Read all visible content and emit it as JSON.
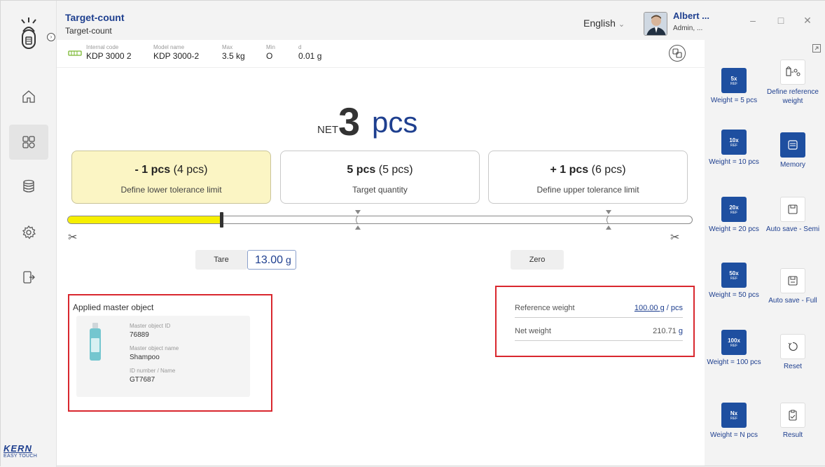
{
  "header": {
    "title": "Target-count",
    "subtitle": "Target-count",
    "language": "English",
    "user_name": "Albert ...",
    "user_role": "Admin, ..."
  },
  "device": {
    "internal_code_label": "Internal code",
    "internal_code": "KDP 3000 2",
    "model_label": "Model name",
    "model": "KDP 3000-2",
    "max_label": "Max",
    "max": "3.5 kg",
    "min_label": "Min",
    "min": "O",
    "d_label": "d",
    "d": "0.01 g"
  },
  "result": {
    "net_label": "NET",
    "value": "3",
    "unit": "pcs"
  },
  "tolerances": {
    "lower_value": "- 1 pcs",
    "lower_paren": "(4 pcs)",
    "lower_label": "Define lower tolerance limit",
    "target_value": "5 pcs",
    "target_paren": "(5 pcs)",
    "target_label": "Target quantity",
    "upper_value": "+ 1 pcs",
    "upper_paren": "(6 pcs)",
    "upper_label": "Define upper tolerance limit"
  },
  "progress": {
    "fill_fraction": 0.246
  },
  "controls": {
    "tare_label": "Tare",
    "tare_value": "13.00",
    "tare_unit": "g",
    "zero_label": "Zero"
  },
  "master": {
    "title": "Applied master object",
    "id_label": "Master object ID",
    "id": "76889",
    "name_label": "Master object name",
    "name": "Shampoo",
    "idnum_label": "ID number / Name",
    "idnum": "GT7687"
  },
  "reference": {
    "ref_label": "Reference weight",
    "ref_value": "100.00 g",
    "ref_unit": "/ pcs",
    "net_label": "Net weight",
    "net_value": "210.71",
    "net_unit": "g"
  },
  "right_panel": {
    "w5_mult": "5x",
    "w5_ref": "REF",
    "w5_label": "Weight = 5 pcs",
    "w10_mult": "10x",
    "w10_ref": "REF",
    "w10_label": "Weight = 10 pcs",
    "w20_mult": "20x",
    "w20_ref": "REF",
    "w20_label": "Weight = 20 pcs",
    "w50_mult": "50x",
    "w50_ref": "REF",
    "w50_label": "Weight = 50 pcs",
    "w100_mult": "100x",
    "w100_ref": "REF",
    "w100_label": "Weight = 100 pcs",
    "wn_mult": "Nx",
    "wn_ref": "REF",
    "wn_label": "Weight = N pcs",
    "define_ref": "Define reference weight",
    "memory": "Memory",
    "autosave_semi": "Auto save - Semi",
    "autosave_full": "Auto save - Full",
    "reset": "Reset",
    "result": "Result"
  },
  "brand": {
    "name": "KERN",
    "tagline": "EASY TOUCH"
  },
  "colors": {
    "accent": "#1e3f8f",
    "button_blue": "#1e4fa0",
    "lower_box": "#fbf5c4",
    "bar_fill": "#f6ef00",
    "highlight": "#d9272e"
  }
}
